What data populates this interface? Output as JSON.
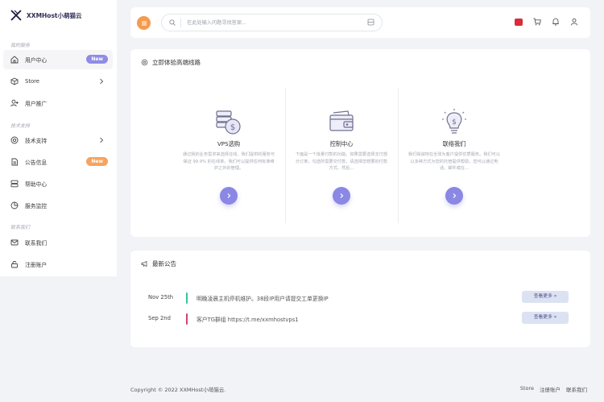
{
  "brand": {
    "name": "XXMHost小萌猫云"
  },
  "sidebar": {
    "sections": [
      "我的服务",
      "技术支持",
      "联系我们"
    ],
    "items": [
      {
        "label": "用户中心",
        "badge": "New"
      },
      {
        "label": "Store"
      },
      {
        "label": "用户推广"
      },
      {
        "label": "技术支持"
      },
      {
        "label": "公告信息",
        "badge": "New"
      },
      {
        "label": "帮助中心"
      },
      {
        "label": "服务监控"
      },
      {
        "label": "联系我们"
      },
      {
        "label": "注册账户"
      }
    ]
  },
  "header": {
    "search_placeholder": "在此处输入问题寻找答案...",
    "colors": {
      "menu_button": "#f59b4d",
      "flag": "#d92b3a"
    }
  },
  "experience": {
    "title": "立即体验高端线路",
    "services": [
      {
        "name": "VPS选购",
        "desc": "通过我的业务需求来选择住线，我们提供的服务可保证 99.9% 的在线率。我们可以提供任何标准维护之外的管理。",
        "icon": "server-coin-icon"
      },
      {
        "name": "控制中心",
        "desc": "下面是一个批量付款的功能。如果需要选择支付部分订单。勾选所需要交付款，请选择您想要的付款方式，然后...",
        "icon": "wallet-icon"
      },
      {
        "name": "联络我们",
        "desc": "我们竭诚地在全球为客户提供优质服务。我们可以以多种方式为您的托管提供帮助，您可以通过电话、邮件或在...",
        "icon": "lightbulb-dollar-icon"
      }
    ],
    "accent": "#8b87e4"
  },
  "notices": {
    "title": "最新公告",
    "more_label": "查看更多 »",
    "items": [
      {
        "date": "Nov 25th",
        "text": "明晚凌晨主机停机维护。38段IP用户请提交工单更换IP",
        "color": "#35c4a2"
      },
      {
        "date": "Sep 2nd",
        "text": "客户TG群组 https://t.me/xxmhostvps1",
        "color": "#d3417a"
      }
    ]
  },
  "footer": {
    "copyright": "Copyright © 2022 XXMHost小萌猫云.",
    "links": [
      "Store",
      "注册账户",
      "联系我们"
    ]
  }
}
